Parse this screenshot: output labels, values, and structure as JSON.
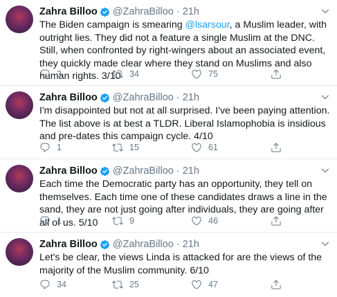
{
  "tweets": [
    {
      "name": "Zahra Billoo",
      "handle": "@ZahraBilloo",
      "dot": "·",
      "time": "21h",
      "text_before": "The Biden campaign is smearing ",
      "mention": "@lsarsour",
      "text_after": ", a Muslim leader, with outright lies. They did not a feature a single Muslim at the DNC. Still, when confronted by right-wingers about an associated event, they quickly made clear where they stand on Muslims and also human rights. 3/10",
      "replies": "3",
      "retweets": "34",
      "likes": "75"
    },
    {
      "name": "Zahra Billoo",
      "handle": "@ZahraBilloo",
      "dot": "·",
      "time": "21h",
      "text": "I'm disappointed but not at all surprised. I've been paying attention. The list above is at best a TLDR. Liberal Islamophobia is insidious and pre-dates this campaign cycle. 4/10",
      "replies": "1",
      "retweets": "15",
      "likes": "61"
    },
    {
      "name": "Zahra Billoo",
      "handle": "@ZahraBilloo",
      "dot": "·",
      "time": "21h",
      "text": "Each time the Democratic party has an opportunity, they tell on themselves. Each time one of these candidates draws a line in the sand, they are not just going after individuals, they are going after all of us. 5/10",
      "replies": "1",
      "retweets": "9",
      "likes": "46"
    },
    {
      "name": "Zahra Billoo",
      "handle": "@ZahraBilloo",
      "dot": "·",
      "time": "21h",
      "text": "Let's be clear, the views Linda is attacked for are the views of the majority of the Muslim community. 6/10",
      "replies": "34",
      "retweets": "25",
      "likes": "47"
    }
  ],
  "colors": {
    "accent": "#1da1f2",
    "muted": "#657786",
    "text": "#14171a",
    "divider": "#e6ecf0"
  },
  "icons": [
    "verified-badge-icon",
    "chevron-down-icon",
    "reply-icon",
    "retweet-icon",
    "like-icon",
    "share-icon"
  ]
}
